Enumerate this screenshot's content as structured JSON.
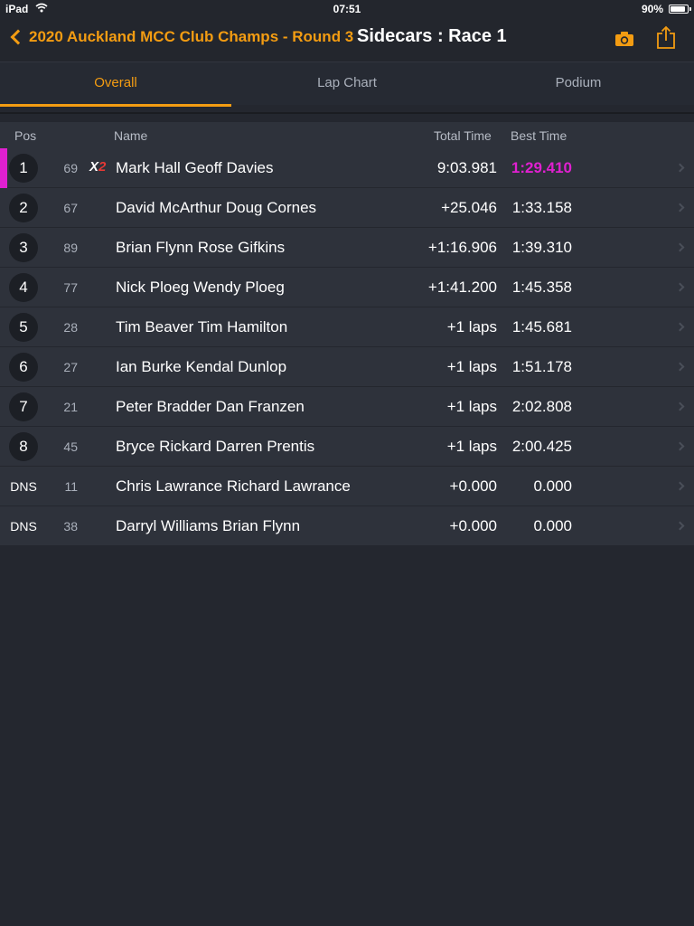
{
  "status_bar": {
    "device": "iPad",
    "time": "07:51",
    "battery_pct": "90%",
    "battery_level": 0.9
  },
  "nav": {
    "back_label": "2020 Auckland MCC Club Champs - Round 3",
    "title": "Sidecars : Race 1"
  },
  "tabs": [
    {
      "label": "Overall",
      "active": true
    },
    {
      "label": "Lap Chart",
      "active": false
    },
    {
      "label": "Podium",
      "active": false
    }
  ],
  "table": {
    "headers": {
      "pos": "Pos",
      "name": "Name",
      "total": "Total Time",
      "best": "Best Time"
    },
    "rows": [
      {
        "pos": "1",
        "number": "69",
        "badge": "X2",
        "name": "Mark Hall Geoff Davies",
        "total": "9:03.981",
        "best": "1:29.410",
        "fastest": true,
        "marker_color": "#e020d0"
      },
      {
        "pos": "2",
        "number": "67",
        "badge": "",
        "name": "David McArthur Doug Cornes",
        "total": "+25.046",
        "best": "1:33.158",
        "fastest": false
      },
      {
        "pos": "3",
        "number": "89",
        "badge": "",
        "name": "Brian Flynn Rose Gifkins",
        "total": "+1:16.906",
        "best": "1:39.310",
        "fastest": false
      },
      {
        "pos": "4",
        "number": "77",
        "badge": "",
        "name": "Nick Ploeg Wendy Ploeg",
        "total": "+1:41.200",
        "best": "1:45.358",
        "fastest": false
      },
      {
        "pos": "5",
        "number": "28",
        "badge": "",
        "name": "Tim Beaver Tim Hamilton",
        "total": "+1 laps",
        "best": "1:45.681",
        "fastest": false
      },
      {
        "pos": "6",
        "number": "27",
        "badge": "",
        "name": "Ian Burke Kendal Dunlop",
        "total": "+1 laps",
        "best": "1:51.178",
        "fastest": false
      },
      {
        "pos": "7",
        "number": "21",
        "badge": "",
        "name": "Peter Bradder Dan Franzen",
        "total": "+1 laps",
        "best": "2:02.808",
        "fastest": false
      },
      {
        "pos": "8",
        "number": "45",
        "badge": "",
        "name": "Bryce Rickard Darren Prentis",
        "total": "+1 laps",
        "best": "2:00.425",
        "fastest": false
      },
      {
        "pos": "DNS",
        "number": "11",
        "badge": "",
        "name": "Chris Lawrance Richard Lawrance",
        "total": "+0.000",
        "best": "0.000",
        "fastest": false
      },
      {
        "pos": "DNS",
        "number": "38",
        "badge": "",
        "name": "Darryl Williams Brian Flynn",
        "total": "+0.000",
        "best": "0.000",
        "fastest": false
      }
    ]
  },
  "colors": {
    "accent": "#f39c12",
    "fastest_lap": "#e020d0",
    "badge_two": "#e53935"
  },
  "icons": {
    "back": "chevron-left-icon",
    "camera": "camera-icon",
    "share": "share-icon",
    "row_disclosure": "chevron-right-icon"
  }
}
